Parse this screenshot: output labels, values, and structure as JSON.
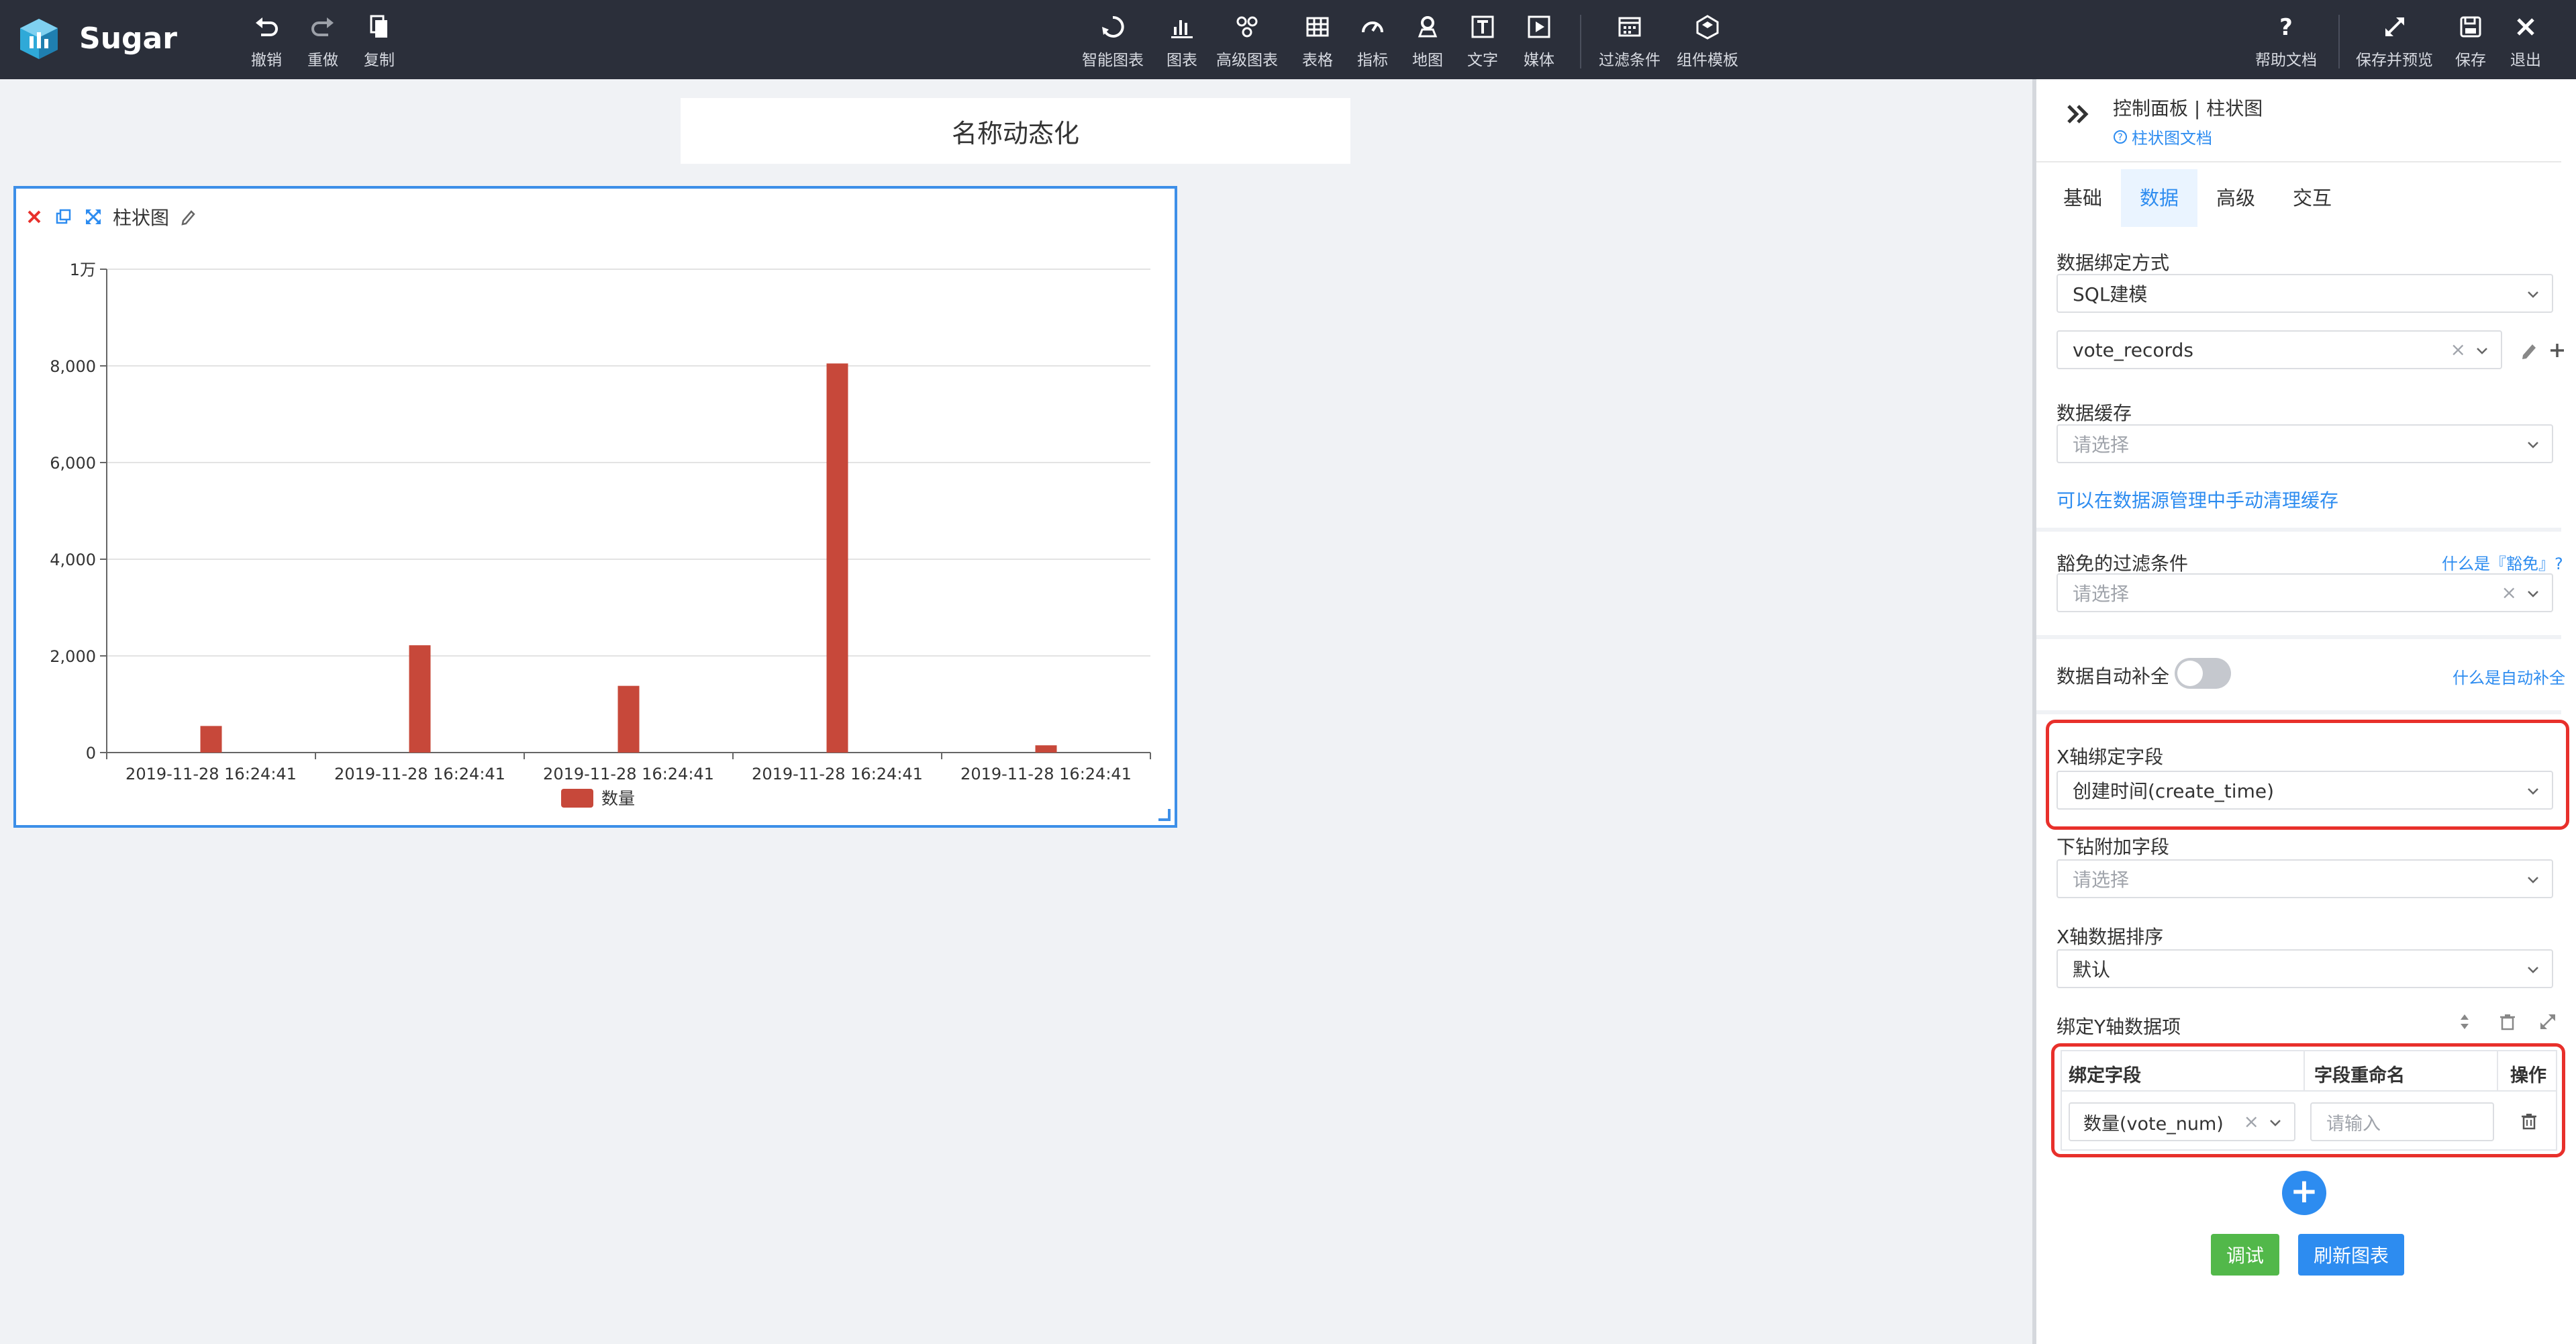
{
  "app": {
    "name": "Sugar"
  },
  "toolbar_left": [
    {
      "label": "撤销",
      "icon": "undo-icon"
    },
    {
      "label": "重做",
      "icon": "redo-icon"
    },
    {
      "label": "复制",
      "icon": "copy-icon"
    }
  ],
  "toolbar_center": [
    {
      "label": "智能图表",
      "icon": "smart-chart-icon"
    },
    {
      "label": "图表",
      "icon": "chart-icon"
    },
    {
      "label": "高级图表",
      "icon": "advanced-chart-icon"
    },
    {
      "label": "表格",
      "icon": "table-icon"
    },
    {
      "label": "指标",
      "icon": "gauge-icon"
    },
    {
      "label": "地图",
      "icon": "map-icon"
    },
    {
      "label": "文字",
      "icon": "text-icon"
    },
    {
      "label": "媒体",
      "icon": "media-icon"
    },
    {
      "label": "过滤条件",
      "icon": "filter-icon"
    },
    {
      "label": "组件模板",
      "icon": "template-icon"
    }
  ],
  "toolbar_right": [
    {
      "label": "帮助文档",
      "icon": "help-icon"
    },
    {
      "label": "保存并预览",
      "icon": "expand-icon"
    },
    {
      "label": "保存",
      "icon": "save-icon"
    },
    {
      "label": "退出",
      "icon": "close-icon"
    }
  ],
  "canvas": {
    "title_card": "名称动态化",
    "chart_card_title": "柱状图"
  },
  "chart_data": {
    "type": "bar",
    "categories": [
      "2019-11-28 16:24:41",
      "2019-11-28 16:24:41",
      "2019-11-28 16:24:41",
      "2019-11-28 16:24:41",
      "2019-11-28 16:24:41"
    ],
    "series": [
      {
        "name": "数量",
        "values": [
          550,
          2220,
          1380,
          8050,
          150
        ]
      }
    ],
    "y_ticks": [
      "0",
      "2,000",
      "4,000",
      "6,000",
      "8,000",
      "1万"
    ],
    "ylim": [
      0,
      10000
    ],
    "grid": true,
    "legend_position": "bottom",
    "bar_color": "#c7483a"
  },
  "panel": {
    "title": "控制面板 | 柱状图",
    "doc_link": "柱状图文档",
    "tabs": [
      "基础",
      "数据",
      "高级",
      "交互"
    ],
    "active_tab": "数据",
    "binding_label": "数据绑定方式",
    "binding_value": "SQL建模",
    "model_value": "vote_records",
    "cache_label": "数据缓存",
    "cache_placeholder": "请选择",
    "cache_link": "可以在数据源管理中手动清理缓存",
    "exempt_label": "豁免的过滤条件",
    "exempt_help": "什么是『豁免』?",
    "exempt_placeholder": "请选择",
    "autofill_label": "数据自动补全",
    "autofill_help": "什么是自动补全",
    "x_field_label": "X轴绑定字段",
    "x_field_value": "创建时间(create_time)",
    "drill_label": "下钻附加字段",
    "drill_placeholder": "请选择",
    "x_sort_label": "X轴数据排序",
    "x_sort_value": "默认",
    "y_items_label": "绑定Y轴数据项",
    "y_table": {
      "headers": [
        "绑定字段",
        "字段重命名",
        "操作"
      ],
      "field_value": "数量(vote_num)",
      "rename_placeholder": "请输入"
    },
    "debug_button": "调试",
    "refresh_button": "刷新图表"
  }
}
